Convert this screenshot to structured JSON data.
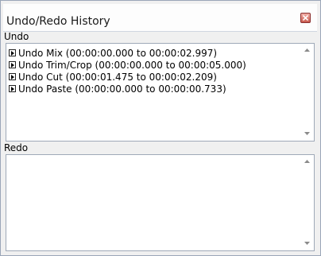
{
  "window": {
    "title": "Undo/Redo History",
    "close_icon": "close-icon"
  },
  "undo": {
    "label": "Undo",
    "items": [
      {
        "icon": "expand-arrow-icon",
        "label": "Undo Mix (00:00:00.000 to 00:00:02.997)"
      },
      {
        "icon": "expand-arrow-icon",
        "label": "Undo Trim/Crop (00:00:00.000 to 00:00:05.000)"
      },
      {
        "icon": "expand-arrow-icon",
        "label": "Undo Cut (00:00:01.475 to 00:00:02.209)"
      },
      {
        "icon": "expand-arrow-icon",
        "label": "Undo Paste (00:00:00.000 to 00:00:00.733)"
      }
    ]
  },
  "redo": {
    "label": "Redo",
    "items": []
  },
  "colors": {
    "close_button": "#c95a4e",
    "border": "#9fa9b8",
    "background": "#f0f0f0"
  }
}
